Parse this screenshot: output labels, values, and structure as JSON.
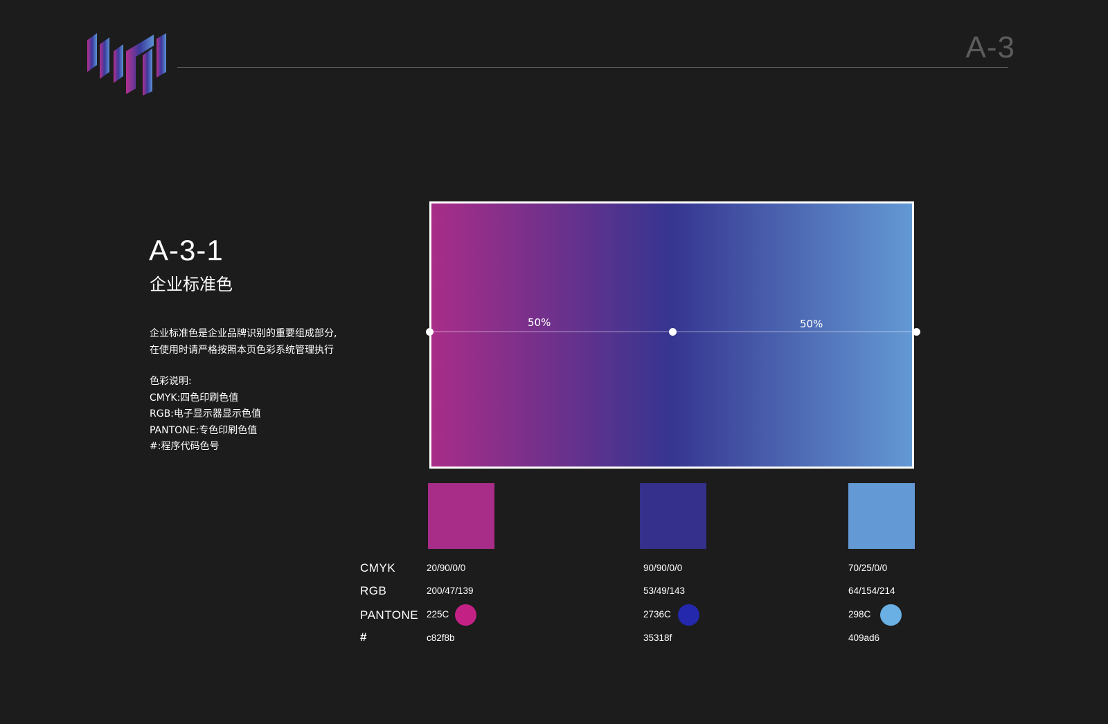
{
  "header": {
    "page_code": "A-3",
    "logo_icon": "brand-bars-logo"
  },
  "section": {
    "number": "A-3-1",
    "title": "企业标准色"
  },
  "description": {
    "lines": [
      "企业标准色是企业品牌识别的重要组成部分,",
      "在使用时请严格按照本页色彩系统管理执行"
    ]
  },
  "notes": {
    "heading": "色彩说明:",
    "items": [
      "CMYK:四色印刷色值",
      "RGB:电子显示器显示色值",
      "PANTONE:专色印刷色值",
      "#:程序代码色号"
    ]
  },
  "gradient": {
    "stops": [
      "#a82d88",
      "#363590",
      "#6399d4"
    ],
    "left_percent": "50%",
    "right_percent": "50%"
  },
  "table": {
    "labels": {
      "cmyk": "CMYK",
      "rgb": "RGB",
      "pantone": "PANTONE",
      "hex": "#"
    },
    "colors": [
      {
        "swatch": "#a82d88",
        "cmyk": "20/90/0/0",
        "rgb": "200/47/139",
        "pantone": "225C",
        "pantone_swatch": "#c42185",
        "hex": "c82f8b"
      },
      {
        "swatch": "#35308c",
        "cmyk": "90/90/0/0",
        "rgb": "53/49/143",
        "pantone": "2736C",
        "pantone_swatch": "#2428ad",
        "hex": "35318f"
      },
      {
        "swatch": "#6399d4",
        "cmyk": "70/25/0/0",
        "rgb": "64/154/214",
        "pantone": "298C",
        "pantone_swatch": "#6ab0e4",
        "hex": "409ad6"
      }
    ]
  }
}
